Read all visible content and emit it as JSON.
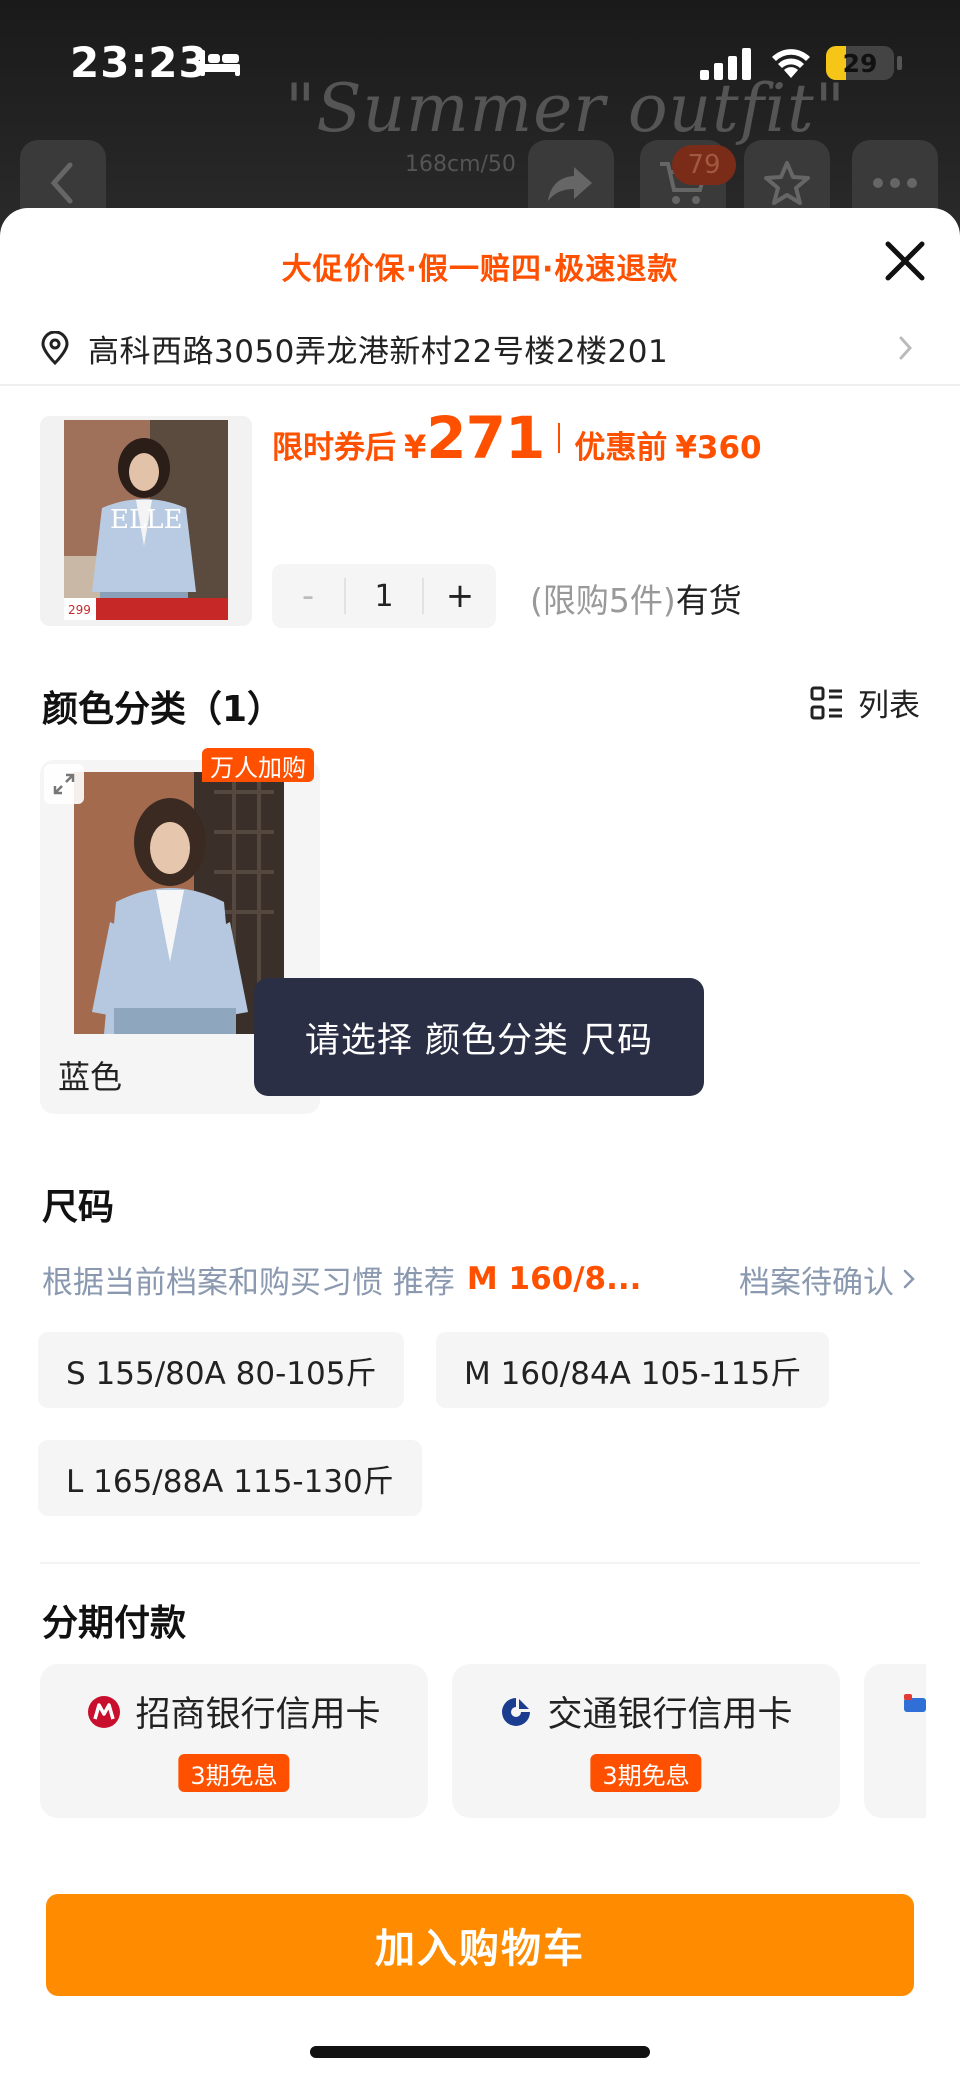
{
  "status_bar": {
    "time": "23:23",
    "battery": "29",
    "battery_level": 0.29
  },
  "background": {
    "watermark": "\"Summer outfit\"",
    "sub_text": "168cm/50",
    "cart_count": "79"
  },
  "sheet": {
    "promo_text": "大促价保·假一赔四·极速退款",
    "address": "高科西路3050弄龙港新村22号楼2楼201"
  },
  "product": {
    "price_label": "限时券后",
    "currency": "¥",
    "price": "271",
    "orig_label": "优惠前",
    "orig_price": "¥360",
    "thumb_brand": "ELLE",
    "thumb_price": "299",
    "quantity": "1",
    "minus": "-",
    "plus": "+",
    "limit_text": "(限购5件)",
    "stock_text": "有货"
  },
  "color_section": {
    "title": "颜色分类（1）",
    "view_toggle": "列表",
    "hot_badge": "万人加购",
    "options": [
      {
        "label": "蓝色"
      }
    ]
  },
  "toast": "请选择 颜色分类 尺码",
  "size_section": {
    "title": "尺码",
    "recommend_text": "根据当前档案和购买习惯 推荐",
    "recommend_size": "M 160/8...",
    "profile_status": "档案待确认",
    "sizes": [
      "S 155/80A 80-105斤",
      "M 160/84A 105-115斤",
      "L 165/88A 115-130斤"
    ]
  },
  "installment_section": {
    "title": "分期付款",
    "options": [
      {
        "bank": "招商银行信用卡",
        "tag": "3期免息"
      },
      {
        "bank": "交通银行信用卡",
        "tag": "3期免息"
      }
    ]
  },
  "cart_button": "加入购物车",
  "colors": {
    "accent": "#ff5000",
    "cart_button": "#ff8c00",
    "toast_bg": "#2a2f45"
  }
}
